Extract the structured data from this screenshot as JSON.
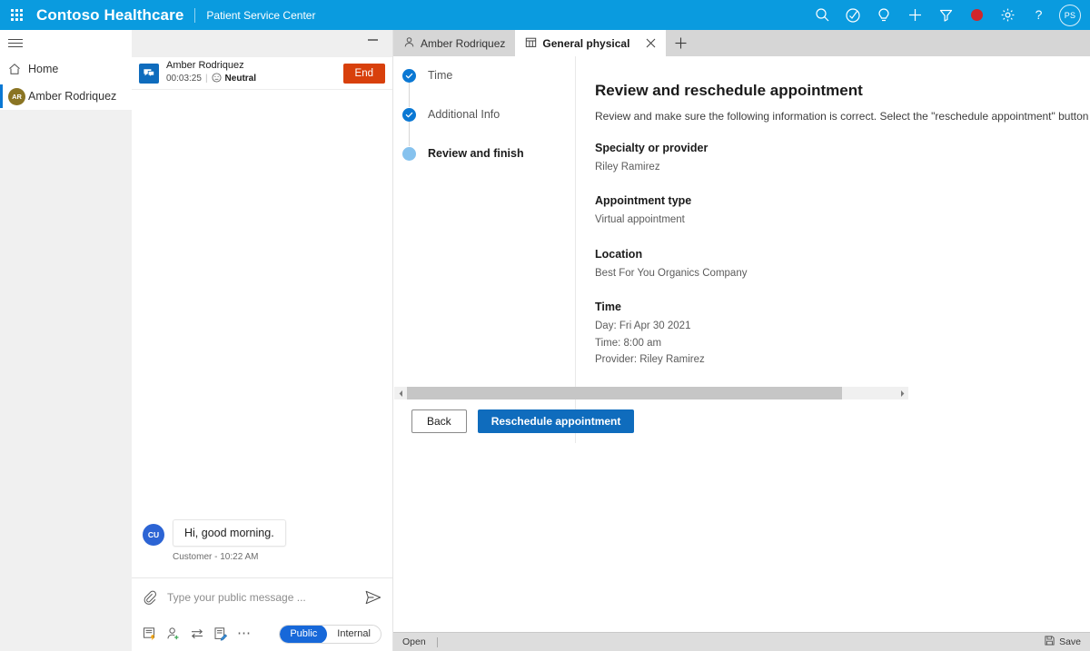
{
  "appbar": {
    "brand": "Contoso Healthcare",
    "subtitle": "Patient Service Center",
    "avatar_initials": "PS",
    "icons": [
      "search-icon",
      "assist-icon",
      "insights-icon",
      "add-icon",
      "filter-icon",
      "record-icon",
      "settings-icon",
      "help-icon"
    ]
  },
  "sidebar": {
    "items": [
      {
        "label": "Home",
        "icon": "home-icon"
      },
      {
        "label": "Amber Rodriquez",
        "icon": "avatar",
        "initials": "AR"
      }
    ]
  },
  "chat": {
    "customer_name": "Amber Rodriquez",
    "duration": "00:03:25",
    "divider": "|",
    "sentiment": "Neutral",
    "end_label": "End",
    "message": {
      "avatar_initials": "CU",
      "text": "Hi, good morning.",
      "caption": "Customer - 10:22 AM"
    },
    "composer": {
      "placeholder": "Type your public message ...",
      "value": "",
      "tools": [
        "quick-replies-icon",
        "add-agent-icon",
        "transfer-icon",
        "notes-icon",
        "more-icon"
      ],
      "toggle": {
        "public": "Public",
        "internal": "Internal",
        "selected": "Public"
      }
    }
  },
  "tabs": [
    {
      "label": "Amber Rodriquez",
      "icon": "person-icon",
      "active": false
    },
    {
      "label": "General physical",
      "icon": "calendar-icon",
      "active": true
    }
  ],
  "stepper": [
    {
      "label": "Time",
      "state": "completed"
    },
    {
      "label": "Additional Info",
      "state": "completed"
    },
    {
      "label": "Review and finish",
      "state": "current"
    }
  ],
  "content": {
    "title": "Review and reschedule appointment",
    "description": "Review and make sure the following information is correct. Select the \"reschedule appointment\" button below to update th",
    "fields": [
      {
        "label": "Specialty or provider",
        "value": "Riley Ramirez"
      },
      {
        "label": "Appointment type",
        "value": "Virtual appointment"
      },
      {
        "label": "Location",
        "value": "Best For You Organics Company"
      },
      {
        "label": "Time",
        "value": "Day: Fri Apr 30 2021\nTime: 8:00 am\nProvider: Riley Ramirez"
      }
    ],
    "buttons": {
      "back": "Back",
      "primary": "Reschedule appointment"
    }
  },
  "statusbar": {
    "state": "Open",
    "save": "Save"
  },
  "colors": {
    "appbar": "#0a9bdf",
    "primary": "#0f6cbd",
    "accent_step": "#0a78d4",
    "end_button": "#d8400c",
    "avatar_nav": "#8a7423",
    "avatar_msg": "#2c64d4"
  }
}
